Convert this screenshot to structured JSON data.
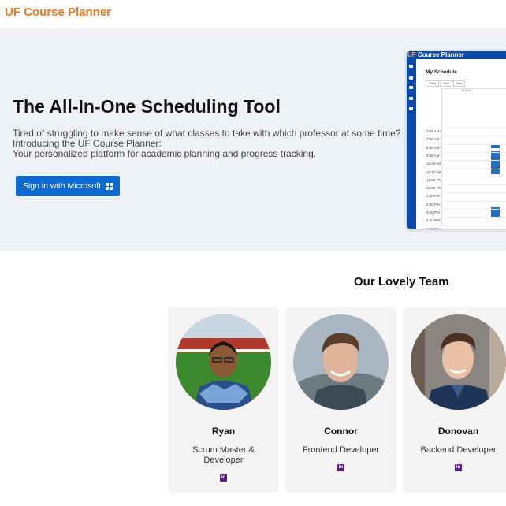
{
  "header": {
    "brand": "UF Course Planner"
  },
  "hero": {
    "title": "The All-In-One Scheduling Tool",
    "desc": [
      "Tired of struggling to make sense of what classes to take with which professor at some time?",
      "Introducing the UF Course Planner:",
      "Your personalized platform for academic planning and progress tracking."
    ],
    "signin_label": "Sign in with Microsoft"
  },
  "preview": {
    "brand_uf": "UF",
    "brand_rest": " Course Planner",
    "schedule_title": "My Schedule",
    "buttons": [
      "Today",
      "Back",
      "Next"
    ],
    "day_label": "01 Sun",
    "times": [
      "7:00 AM",
      "7:50 AM",
      "8:40 AM",
      "9:30 AM",
      "10:20 AM",
      "11:10 AM",
      "12:00 PM",
      "12:50 PM",
      "1:40 PM",
      "2:30 PM",
      "3:20 PM",
      "4:10 PM",
      "5:00 PM",
      "5:50 PM",
      "6:40 PM"
    ]
  },
  "team": {
    "title": "Our Lovely Team",
    "members": [
      {
        "name": "Ryan",
        "role": "Scrum Master & Developer"
      },
      {
        "name": "Connor",
        "role": "Frontend Developer"
      },
      {
        "name": "Donovan",
        "role": "Backend Developer"
      }
    ],
    "link_icon": "linkedin-icon"
  },
  "colors": {
    "brand_orange": "#e87722",
    "hero_bg": "#eef1f6",
    "button_blue": "#0b6ad4",
    "linkedin_purple": "#5a1a8c"
  }
}
